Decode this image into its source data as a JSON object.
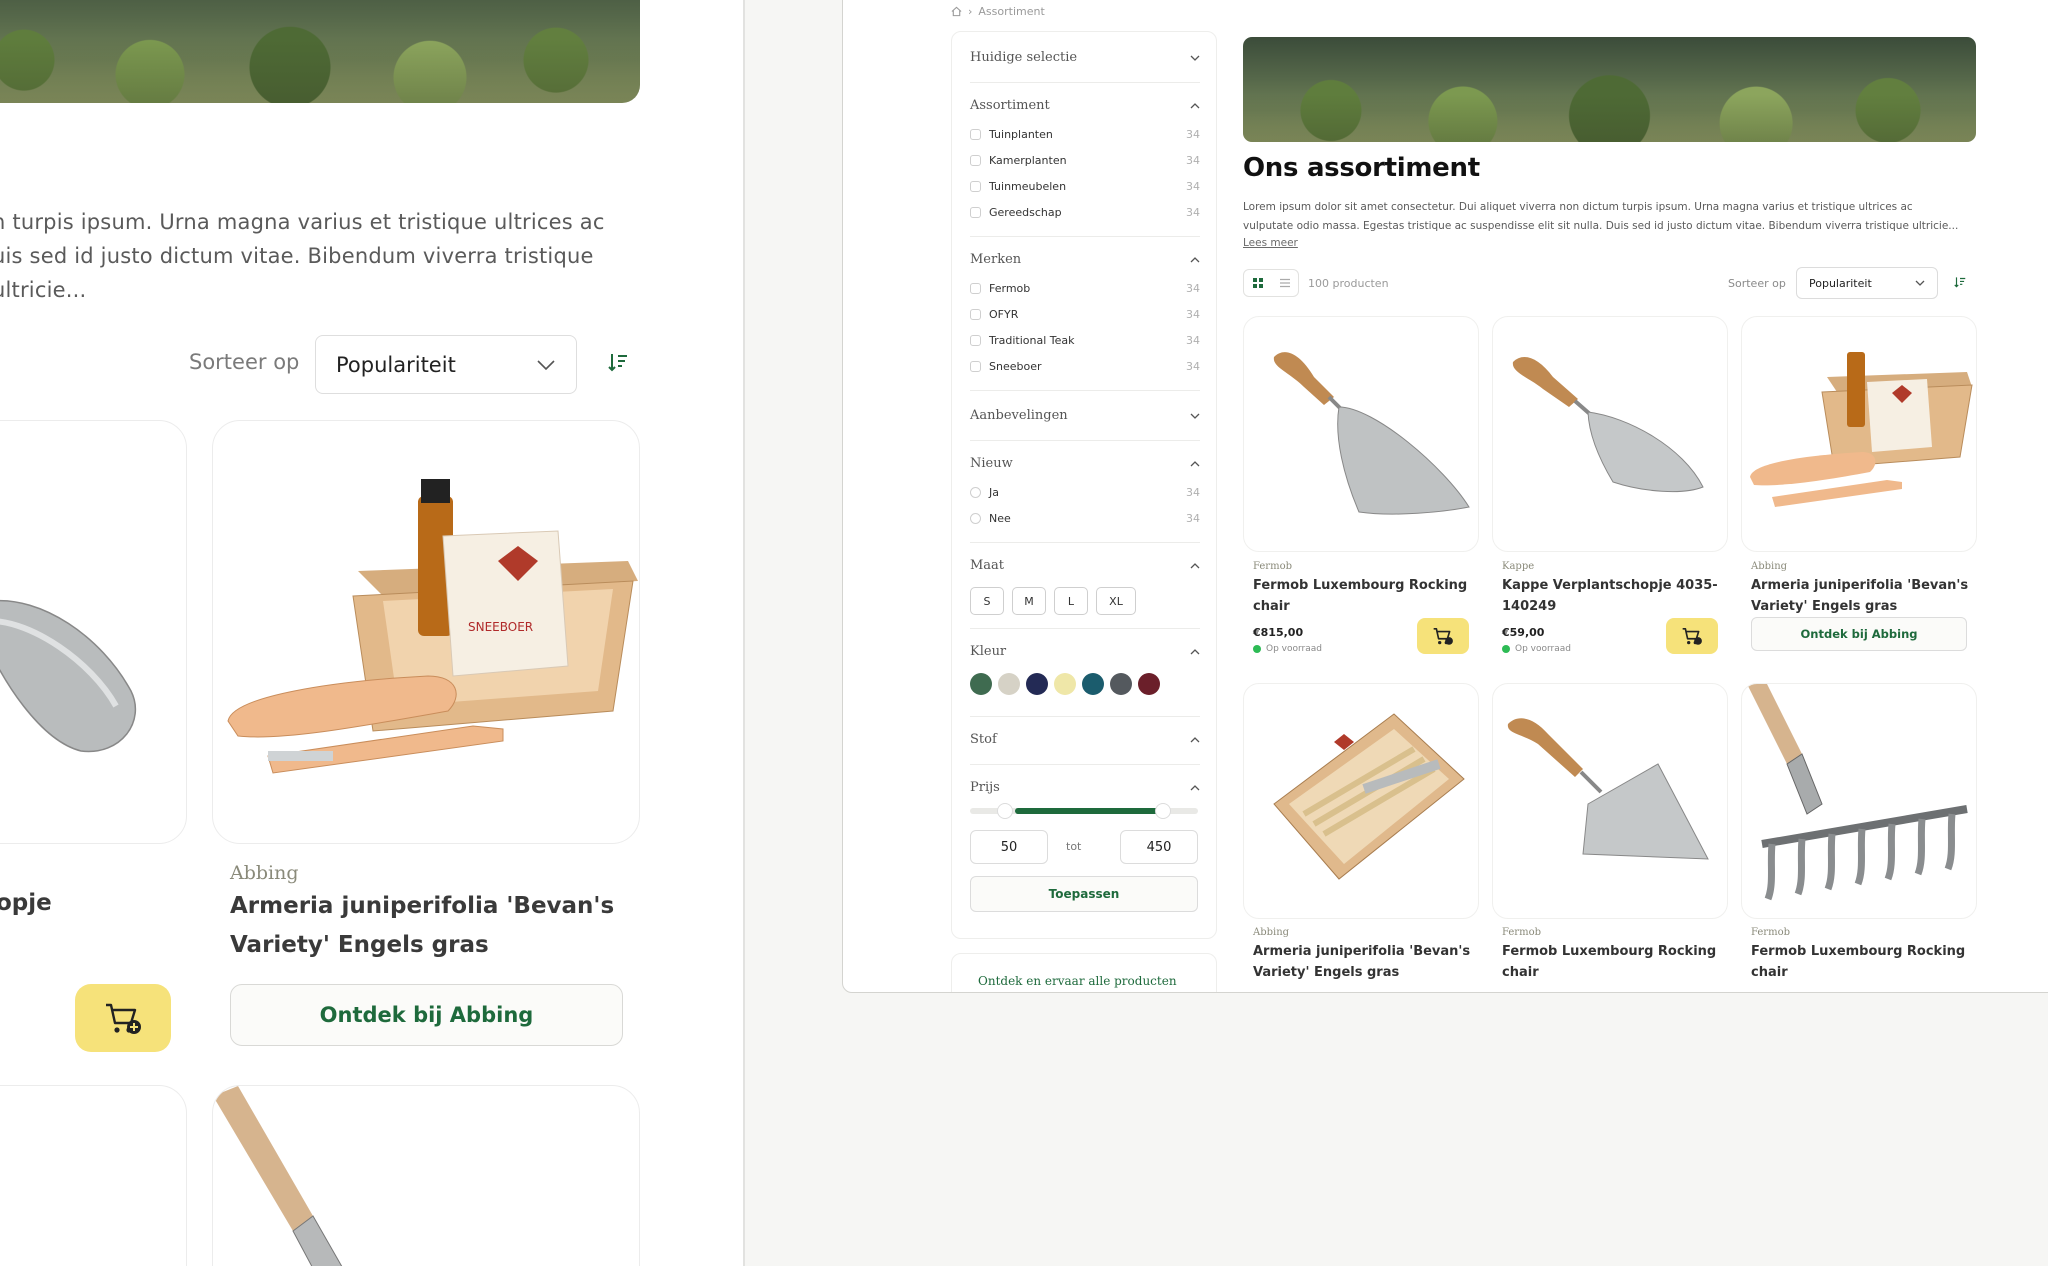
{
  "left": {
    "description_lines": [
      "n turpis ipsum. Urna magna varius et tristique ultrices ac",
      "uis sed id justo dictum vitae. Bibendum viverra tristique ultricie..."
    ],
    "sort_label": "Sorteer op",
    "sort_value": "Populariteit",
    "partial_title": "opje",
    "card": {
      "brand": "Abbing",
      "title": "Armeria juniperifolia 'Bevan's Variety' Engels gras",
      "discover": "Ontdek bij Abbing"
    }
  },
  "right": {
    "breadcrumb": "Assortiment",
    "sidebar": {
      "current_selection": "Huidige selectie",
      "assortment": {
        "title": "Assortiment",
        "options": [
          {
            "label": "Tuinplanten",
            "count": "34"
          },
          {
            "label": "Kamerplanten",
            "count": "34"
          },
          {
            "label": "Tuinmeubelen",
            "count": "34"
          },
          {
            "label": "Gereedschap",
            "count": "34"
          }
        ]
      },
      "brands": {
        "title": "Merken",
        "options": [
          {
            "label": "Fermob",
            "count": "34"
          },
          {
            "label": "OFYR",
            "count": "34"
          },
          {
            "label": "Traditional Teak",
            "count": "34"
          },
          {
            "label": "Sneeboer",
            "count": "34"
          }
        ]
      },
      "recommendations": "Aanbevelingen",
      "new": {
        "title": "Nieuw",
        "options": [
          {
            "label": "Ja",
            "count": "34"
          },
          {
            "label": "Nee",
            "count": "34"
          }
        ]
      },
      "size": {
        "title": "Maat",
        "options": [
          "S",
          "M",
          "L",
          "XL"
        ]
      },
      "color": {
        "title": "Kleur",
        "swatches": [
          "#3f6b50",
          "#d6d2c6",
          "#232a55",
          "#efe7a8",
          "#1b5c6d",
          "#54595e",
          "#6b1f2a"
        ]
      },
      "fabric": "Stof",
      "price": {
        "title": "Prijs",
        "min": "50",
        "separator": "tot",
        "max": "450",
        "apply": "Toepassen"
      }
    },
    "discover_all": "Ontdek en ervaar alle producten",
    "title": "Ons assortiment",
    "description_lines": [
      "Lorem ipsum dolor sit amet consectetur. Dui aliquet viverra non dictum turpis ipsum. Urna magna varius et tristique ultrices ac",
      "vulputate odio massa. Egestas tristique ac suspendisse elit sit nulla. Duis sed id justo dictum vitae. Bibendum viverra tristique ultricie..."
    ],
    "read_more": "Lees meer",
    "result_count": "100 producten",
    "sort_label": "Sorteer op",
    "sort_value": "Populariteit",
    "products": [
      {
        "brand": "Fermob",
        "title": "Fermob Luxembourg Rocking chair",
        "price": "€815,00",
        "stock": "Op voorraad",
        "image": "trowel-wide"
      },
      {
        "brand": "Kappe",
        "title": "Kappe Verplantschopje 4035-140249",
        "price": "€59,00",
        "stock": "Op voorraad",
        "image": "trowel-narrow"
      },
      {
        "brand": "Abbing",
        "title": "Armeria juniperifolia 'Bevan's Variety' Engels gras",
        "discover": "Ontdek bij Abbing",
        "image": "gift-box"
      },
      {
        "brand": "Abbing",
        "title": "Armeria juniperifolia 'Bevan's Variety' Engels gras",
        "image": "tool-box"
      },
      {
        "brand": "Fermob",
        "title": "Fermob Luxembourg Rocking chair",
        "image": "hoe"
      },
      {
        "brand": "Fermob",
        "title": "Fermob Luxembourg Rocking chair",
        "image": "rake"
      }
    ]
  },
  "colors": {
    "accent_green": "#1e6a3c",
    "cart_yellow": "#f6e27a",
    "stock_green": "#2dbb55"
  }
}
